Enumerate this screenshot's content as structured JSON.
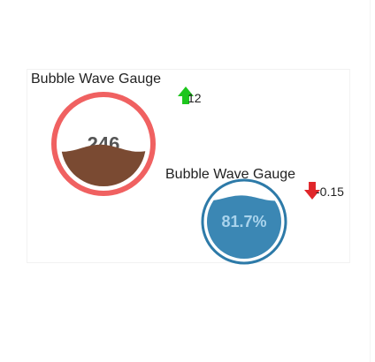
{
  "chart_data": [
    {
      "type": "gauge",
      "title": "Bubble Wave Gauge",
      "value": 246,
      "value_label": "246",
      "fill_fraction": 0.45,
      "change": 12,
      "change_label": "12",
      "trend": "up",
      "ring_color": "#f06161",
      "wave_color": "#7a4a32",
      "text_color": "#555555",
      "arrow_color": "#1cc61c"
    },
    {
      "type": "gauge",
      "title": "Bubble Wave Gauge",
      "value": 81.7,
      "value_label": "81.7%",
      "fill_fraction": 0.817,
      "change": -0.15,
      "change_label": "-0.15",
      "trend": "down",
      "ring_color": "#2d7aa8",
      "wave_color": "#3b87b4",
      "text_color": "#a9d3ec",
      "arrow_color": "#e0262a"
    }
  ]
}
